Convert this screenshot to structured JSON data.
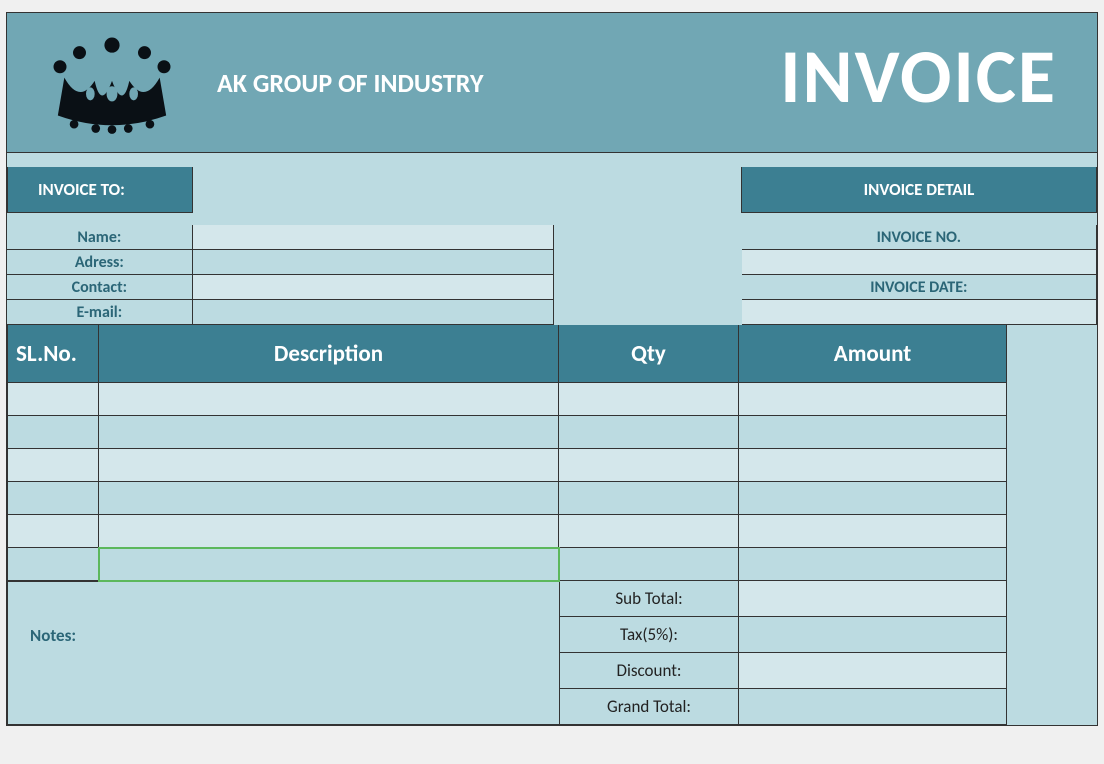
{
  "header": {
    "company": "AK GROUP OF INDUSTRY",
    "title": "INVOICE"
  },
  "invoice_to": {
    "heading": "INVOICE TO:",
    "fields": [
      {
        "label": "Name:",
        "value": ""
      },
      {
        "label": "Adress:",
        "value": ""
      },
      {
        "label": "Contact:",
        "value": ""
      },
      {
        "label": "E-mail:",
        "value": ""
      }
    ]
  },
  "invoice_detail": {
    "heading": "INVOICE DETAIL",
    "no_label": "INVOICE NO.",
    "no_value": "",
    "date_label": "INVOICE DATE:",
    "date_value": ""
  },
  "table": {
    "headers": {
      "sl": "SL.No.",
      "desc": "Description",
      "qty": "Qty",
      "amount": "Amount"
    },
    "rows": [
      {
        "sl": "",
        "desc": "",
        "qty": "",
        "amount": ""
      },
      {
        "sl": "",
        "desc": "",
        "qty": "",
        "amount": ""
      },
      {
        "sl": "",
        "desc": "",
        "qty": "",
        "amount": ""
      },
      {
        "sl": "",
        "desc": "",
        "qty": "",
        "amount": ""
      },
      {
        "sl": "",
        "desc": "",
        "qty": "",
        "amount": ""
      },
      {
        "sl": "",
        "desc": "",
        "qty": "",
        "amount": ""
      }
    ]
  },
  "totals": {
    "subtotal_label": "Sub Total:",
    "subtotal": "",
    "tax_label": "Tax(5%):",
    "tax": "",
    "discount_label": "Discount:",
    "discount": "",
    "grand_label": "Grand Total:",
    "grand": ""
  },
  "notes": {
    "label": "Notes:"
  }
}
